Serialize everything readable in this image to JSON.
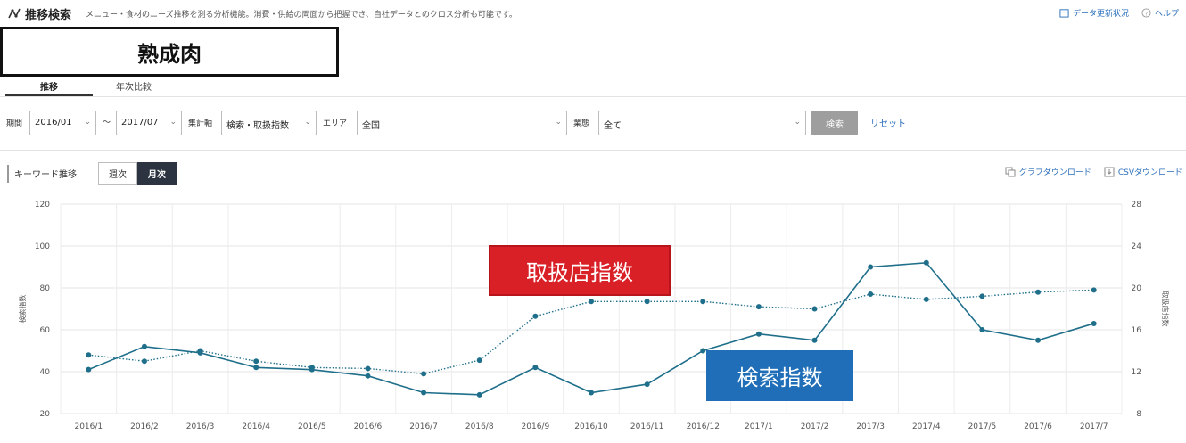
{
  "header": {
    "title": "推移検索",
    "description": "メニュー・食材のニーズ推移を測る分析機能。消費・供給の両面から把握でき、自社データとのクロス分析も可能です。",
    "links": [
      {
        "label": "データ更新状況",
        "icon": "calendar-icon"
      },
      {
        "label": "ヘルプ",
        "icon": "help-icon"
      }
    ]
  },
  "keyword": "熟成肉",
  "tabs": [
    {
      "label": "推移",
      "active": true
    },
    {
      "label": "年次比較",
      "active": false
    }
  ],
  "filters": {
    "period_label": "期間",
    "start": "2016/01",
    "separator": "〜",
    "end": "2017/07",
    "axis_label": "集計軸",
    "axis_value": "検索・取扱指数",
    "area_label": "エリア",
    "area_value": "全国",
    "industry_label": "業態",
    "industry_value": "全て",
    "search_button": "検索",
    "reset_link": "リセット"
  },
  "trend": {
    "label": "キーワード推移",
    "toggle": [
      {
        "label": "週次",
        "active": false
      },
      {
        "label": "月次",
        "active": true
      }
    ],
    "downloads": [
      {
        "label": "グラフダウンロード",
        "icon": "copy-icon"
      },
      {
        "label": "CSVダウンロード",
        "icon": "download-icon"
      }
    ]
  },
  "annotations": {
    "handling": "取扱店指数",
    "search": "検索指数"
  },
  "colors": {
    "series": "#1f6f8b",
    "annotation_red": "#d92027",
    "annotation_blue": "#1f6eb7",
    "link": "#2a6ebb"
  },
  "chart_data": {
    "type": "line",
    "categories": [
      "2016/1",
      "2016/2",
      "2016/3",
      "2016/4",
      "2016/5",
      "2016/6",
      "2016/7",
      "2016/8",
      "2016/9",
      "2016/10",
      "2016/11",
      "2016/12",
      "2017/1",
      "2017/2",
      "2017/3",
      "2017/4",
      "2017/5",
      "2017/6",
      "2017/7"
    ],
    "ylabel_left": "検索指数",
    "ylabel_right": "取扱店指数",
    "ylim_left": [
      20,
      120
    ],
    "yticks_left": [
      20,
      40,
      60,
      80,
      100,
      120
    ],
    "ylim_right": [
      8,
      28
    ],
    "yticks_right": [
      8,
      12,
      16,
      20,
      24,
      28
    ],
    "grid": true,
    "series": [
      {
        "name": "検索指数",
        "axis": "left",
        "style": "solid",
        "values": [
          41,
          52,
          49,
          42,
          41,
          38,
          30,
          29,
          42,
          30,
          34,
          50,
          58,
          55,
          90,
          92,
          60,
          55,
          63
        ]
      },
      {
        "name": "取扱店指数",
        "axis": "right",
        "style": "dotted",
        "values": [
          13.6,
          13.0,
          14.0,
          13.0,
          12.4,
          12.3,
          11.8,
          13.1,
          17.3,
          18.7,
          18.7,
          18.7,
          18.2,
          18.0,
          19.4,
          18.9,
          19.2,
          19.6,
          19.8
        ]
      }
    ]
  }
}
